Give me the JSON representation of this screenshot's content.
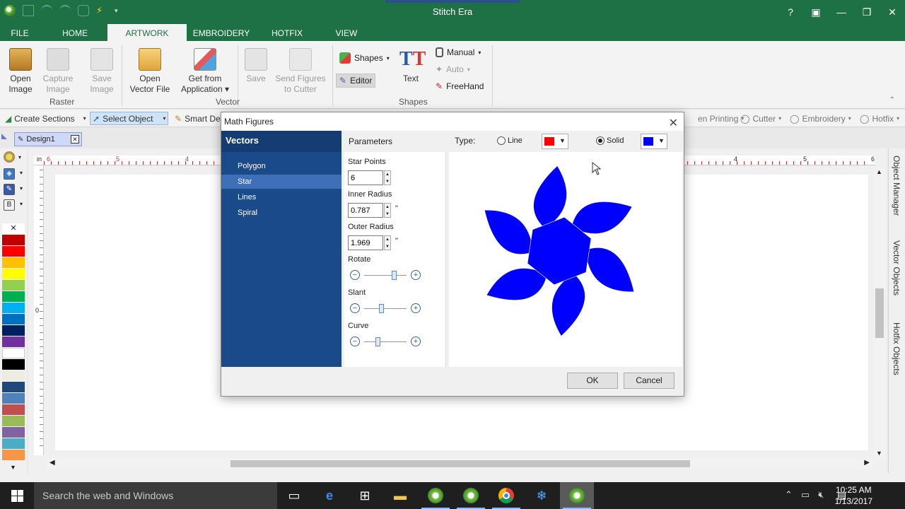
{
  "app": {
    "title": "Stitch Era",
    "window_controls": [
      "?",
      "▣",
      "—",
      "❐",
      "✕"
    ]
  },
  "tabs": [
    {
      "label": "FILE",
      "active": false
    },
    {
      "label": "HOME",
      "active": false
    },
    {
      "label": "ARTWORK",
      "active": true
    },
    {
      "label": "EMBROIDERY",
      "active": false
    },
    {
      "label": "HOTFIX",
      "active": false
    },
    {
      "label": "VIEW",
      "active": false
    }
  ],
  "ribbon": {
    "raster": {
      "label": "Raster",
      "open_image": [
        "Open",
        "Image"
      ],
      "capture": [
        "Capture",
        "Image"
      ],
      "save_image": [
        "Save",
        "Image"
      ]
    },
    "vector": {
      "label": "Vector",
      "open_vector": [
        "Open",
        "Vector File"
      ],
      "get_from_app": [
        "Get from",
        "Application ▾"
      ],
      "save": [
        "Save"
      ],
      "send_figures": [
        "Send Figures",
        "to Cutter"
      ]
    },
    "shapes": {
      "label": "Shapes",
      "shapes_btn": "Shapes",
      "editor_btn": "Editor",
      "text_btn": "Text",
      "manual_btn": "Manual",
      "auto_btn": "Auto",
      "freehand_btn": "FreeHand"
    }
  },
  "toolbar2": {
    "create_sections": "Create Sections",
    "select_object": "Select Object",
    "smart_design": "Smart De",
    "pen_printing": "en Printing",
    "cutter": "Cutter",
    "embroidery": "Embroidery",
    "hotfix": "Hotfix"
  },
  "document": {
    "tab_name": "Design1"
  },
  "ruler": {
    "unit": "in",
    "top_left_labels": [
      "6",
      "5",
      "4"
    ],
    "top_right_labels": [
      "4",
      "5",
      "6"
    ],
    "left_labels": [
      "0"
    ]
  },
  "palette": {
    "colors": [
      "#c00000",
      "#ff0000",
      "#ffc000",
      "#ffff00",
      "#92d050",
      "#00b050",
      "#00b0f0",
      "#0070c0",
      "#002060",
      "#7030a0",
      "#ffffff",
      "#000000",
      "#eeece1",
      "#1f497d",
      "#4f81bd",
      "#c0504d",
      "#9bbb59",
      "#8064a2",
      "#4bacc6",
      "#f79646"
    ]
  },
  "right_dock": {
    "panels": [
      "Object Manager",
      "Vector Objects",
      "Hotfix Objects"
    ]
  },
  "dialog": {
    "title": "Math Figures",
    "vectors_header": "Vectors",
    "vector_items": [
      "Polygon",
      "Star",
      "Lines",
      "Spiral"
    ],
    "selected_vector": "Star",
    "parameters_header": "Parameters",
    "type_label": "Type:",
    "line_option": "Line",
    "solid_option": "Solid",
    "selected_type": "Solid",
    "line_color": "#ff0000",
    "solid_color": "#0000ff",
    "star_points_label": "Star Points",
    "star_points_value": "6",
    "inner_radius_label": "Inner Radius",
    "inner_radius_value": "0.787",
    "outer_radius_label": "Outer Radius",
    "outer_radius_value": "1.969",
    "unit_symbol": "\"",
    "rotate_label": "Rotate",
    "rotate_level": 0.72,
    "slant_label": "Slant",
    "slant_level": 0.38,
    "curve_label": "Curve",
    "curve_level": 0.3,
    "ok_label": "OK",
    "cancel_label": "Cancel"
  },
  "taskbar": {
    "search_placeholder": "Search the web and Windows",
    "time": "10:25 AM",
    "date": "1/13/2017"
  }
}
